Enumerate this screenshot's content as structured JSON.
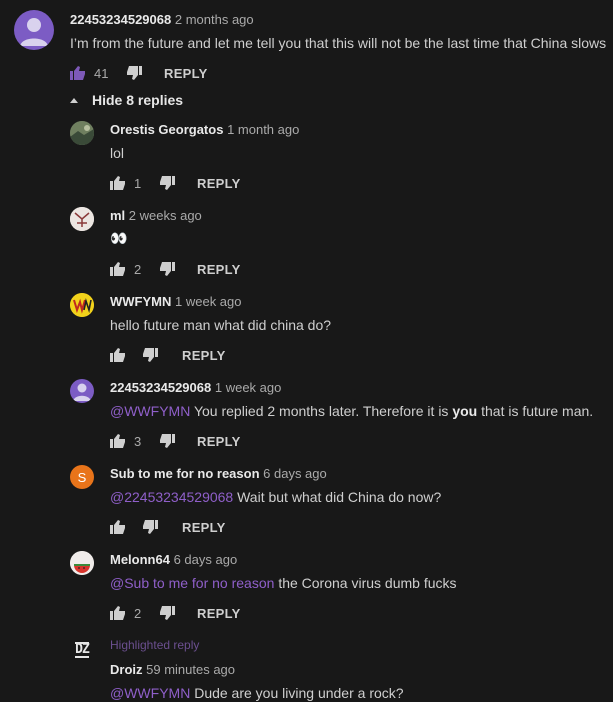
{
  "top_comment": {
    "author": "22453234529068",
    "time": "2 months ago",
    "text": "I’m from the future and let me tell you that this will not be the last time that China slows",
    "likes": "41",
    "reply_label": "REPLY",
    "avatar_color": "#7c5cc4"
  },
  "hide_replies_label": "Hide 8 replies",
  "replies": [
    {
      "author": "Orestis Georgatos",
      "time": "1 month ago",
      "text": "lol",
      "likes": "1",
      "reply_label": "REPLY"
    },
    {
      "author": "ml",
      "time": "2 weeks ago",
      "text": "👀",
      "likes": "2",
      "reply_label": "REPLY"
    },
    {
      "author": "WWFYMN",
      "time": "1 week ago",
      "text": "hello future man what did china do?",
      "likes": "",
      "reply_label": "REPLY"
    },
    {
      "author": "22453234529068",
      "time": "1 week ago",
      "mention": "@WWFYMN",
      "text_a": "You replied 2 months later. Therefore it is ",
      "text_bold": "you",
      "text_b": " that is future man.",
      "likes": "3",
      "reply_label": "REPLY"
    },
    {
      "author": "Sub to me for no reason",
      "time": "6 days ago",
      "mention": "@22453234529068",
      "text": "Wait but what did China do now?",
      "likes": "",
      "reply_label": "REPLY",
      "avatar_letter": "S",
      "avatar_color": "#e8741a"
    },
    {
      "author": "Melonn64",
      "time": "6 days ago",
      "mention": "@Sub to me for no reason",
      "text": "the Corona virus dumb fucks",
      "likes": "2",
      "reply_label": "REPLY"
    },
    {
      "highlight_label": "Highlighted reply",
      "author": "Droiz",
      "time": "59 minutes ago",
      "mention": "@WWFYMN",
      "text": "Dude are you living under a rock?",
      "avatar_text": "DZ"
    }
  ],
  "colors": {
    "accent": "#8f5fc9",
    "background": "#181818"
  }
}
